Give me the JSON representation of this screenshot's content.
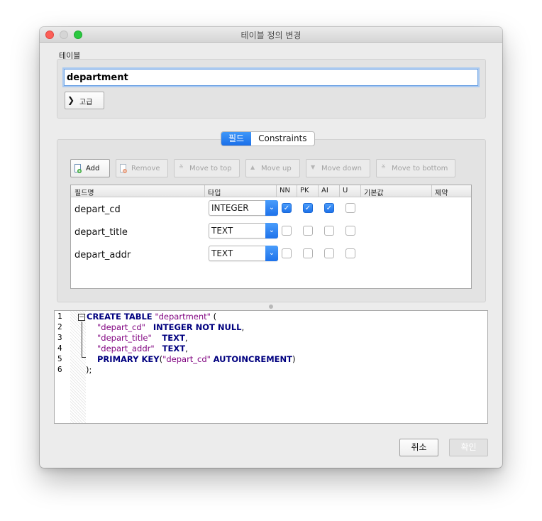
{
  "window": {
    "title": "테이블 정의 변경"
  },
  "table_section": {
    "label": "테이블",
    "name_value": "department",
    "advanced_label": "고급"
  },
  "tabs": [
    {
      "label": "필드",
      "active": true
    },
    {
      "label": "Constraints",
      "active": false
    }
  ],
  "toolbar": {
    "add": "Add",
    "remove": "Remove",
    "move_to_top": "Move to top",
    "move_up": "Move up",
    "move_down": "Move down",
    "move_to_bottom": "Move to bottom"
  },
  "grid": {
    "columns": [
      "필드명",
      "타입",
      "NN",
      "PK",
      "AI",
      "U",
      "기본값",
      "제약"
    ],
    "rows": [
      {
        "name": "depart_cd",
        "type": "INTEGER",
        "nn": true,
        "pk": true,
        "ai": true,
        "u": false
      },
      {
        "name": "depart_title",
        "type": "TEXT",
        "nn": false,
        "pk": false,
        "ai": false,
        "u": false
      },
      {
        "name": "depart_addr",
        "type": "TEXT",
        "nn": false,
        "pk": false,
        "ai": false,
        "u": false
      }
    ]
  },
  "sql": {
    "line_numbers": [
      "1",
      "2",
      "3",
      "4",
      "5",
      "6"
    ],
    "l1_kw": "CREATE TABLE",
    "l1_name": "\"department\"",
    "l1_paren": " (",
    "l2_col": "\"depart_cd\"",
    "l2_type": "INTEGER NOT NULL",
    "l2_end": ",",
    "l3_col": "\"depart_title\"",
    "l3_type": "TEXT",
    "l3_end": ",",
    "l4_col": "\"depart_addr\"",
    "l4_type": "TEXT",
    "l4_end": ",",
    "l5_kw": "PRIMARY KEY",
    "l5_open": "(",
    "l5_col": "\"depart_cd\"",
    "l5_ai": "AUTOINCREMENT",
    "l5_close": ")",
    "l6": ");"
  },
  "buttons": {
    "cancel": "취소",
    "ok": "확인"
  },
  "colors": {
    "accent": "#1e72ea",
    "keyword": "#00007f",
    "string": "#7f007f"
  }
}
